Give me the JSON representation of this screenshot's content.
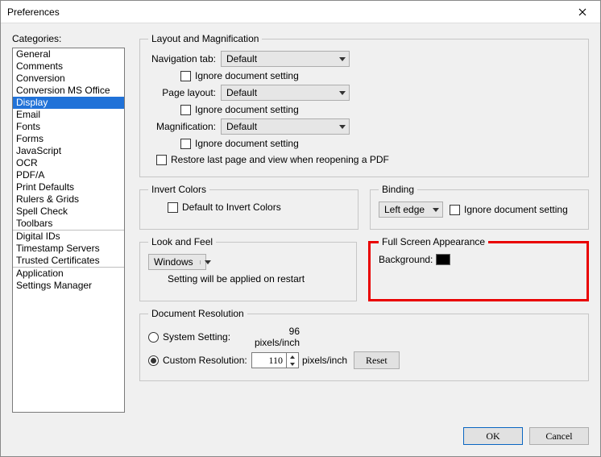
{
  "window": {
    "title": "Preferences"
  },
  "categories": {
    "label": "Categories:",
    "groups": [
      [
        "General",
        "Comments",
        "Conversion",
        "Conversion MS Office",
        "Display",
        "Email",
        "Fonts",
        "Forms",
        "JavaScript",
        "OCR",
        "PDF/A",
        "Print Defaults",
        "Rulers & Grids",
        "Spell Check",
        "Toolbars"
      ],
      [
        "Digital IDs",
        "Timestamp Servers",
        "Trusted Certificates"
      ],
      [
        "Application",
        "Settings Manager"
      ]
    ],
    "selected": "Display"
  },
  "layoutMag": {
    "legend": "Layout and Magnification",
    "navTabLabel": "Navigation tab:",
    "navTabValue": "Default",
    "pageLayoutLabel": "Page layout:",
    "pageLayoutValue": "Default",
    "magLabel": "Magnification:",
    "magValue": "Default",
    "ignore": "Ignore document setting",
    "restore": "Restore last page and view when reopening a PDF"
  },
  "invert": {
    "legend": "Invert Colors",
    "default": "Default to Invert Colors"
  },
  "binding": {
    "legend": "Binding",
    "value": "Left edge",
    "ignore": "Ignore document setting"
  },
  "lookFeel": {
    "legend": "Look and Feel",
    "value": "Windows",
    "note": "Setting will be applied on restart"
  },
  "fullscreen": {
    "legend": "Full Screen Appearance",
    "bgLabel": "Background:",
    "bgColor": "#000000"
  },
  "docRes": {
    "legend": "Document Resolution",
    "systemLabel": "System Setting:",
    "systemValue": "96 pixels/inch",
    "customLabel": "Custom Resolution:",
    "customValue": "110",
    "customUnit": "pixels/inch",
    "reset": "Reset"
  },
  "buttons": {
    "ok": "OK",
    "cancel": "Cancel"
  }
}
